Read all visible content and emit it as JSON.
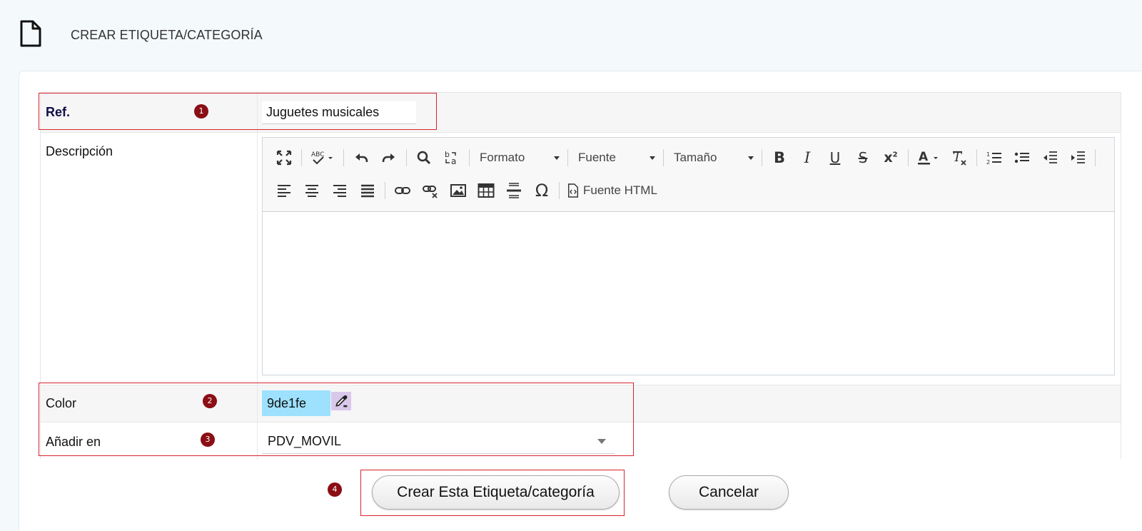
{
  "header": {
    "icon": "document-icon",
    "title": "CREAR ETIQUETA/CATEGORÍA"
  },
  "form": {
    "ref": {
      "label": "Ref.",
      "value": "Juguetes musicales",
      "step": "1"
    },
    "description": {
      "label": "Descripción",
      "toolbar": {
        "format": "Formato",
        "font": "Fuente",
        "size": "Tamaño",
        "source": "Fuente HTML"
      }
    },
    "color": {
      "label": "Color",
      "value": "9de1fe",
      "step": "2",
      "swatch": "#9de1fe"
    },
    "add_in": {
      "label": "Añadir en",
      "value": "PDV_MOVIL",
      "step": "3"
    }
  },
  "actions": {
    "step": "4",
    "create": "Crear Esta Etiqueta/categoría",
    "cancel": "Cancelar"
  },
  "colors": {
    "highlight": "#d9232b",
    "badge": "#8a0e14"
  }
}
